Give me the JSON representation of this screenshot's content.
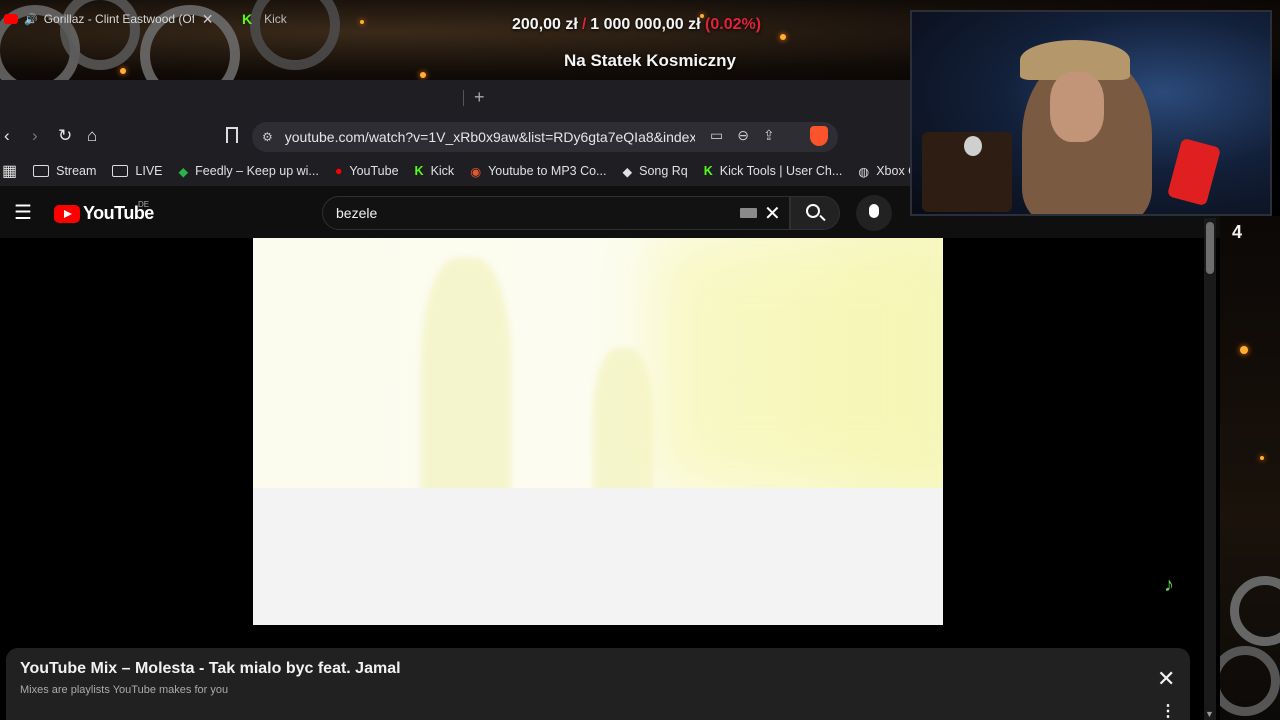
{
  "overlay": {
    "goal_current": "200,00 zł",
    "goal_arrow": "/",
    "goal_target": "1 000 000,00 zł",
    "goal_percent": "(0.02%)",
    "goal_title": "Na Statek Kosmiczny",
    "right_number": "4"
  },
  "browser": {
    "tabs": [
      {
        "label": "Gorillaz - Clint Eastwood (Offi"
      },
      {
        "label": "Kick"
      }
    ],
    "new_tab": "+",
    "url": "youtube.com/watch?v=1V_xRb0x9aw&list=RDy6gta7eQIa8&index...",
    "bookmarks": [
      {
        "label": "Stream"
      },
      {
        "label": "LIVE"
      },
      {
        "label": "Feedly – Keep up wi..."
      },
      {
        "label": "YouTube"
      },
      {
        "label": "Kick"
      },
      {
        "label": "Youtube to MP3 Co..."
      },
      {
        "label": "Song Rq"
      },
      {
        "label": "Kick Tools | User Ch..."
      },
      {
        "label": "Xbox Cl"
      }
    ]
  },
  "youtube": {
    "logo": "YouTube",
    "region": "DE",
    "search_value": "bezele",
    "mix_title": "YouTube Mix – Molesta - Tak mialo byc feat. Jamal",
    "mix_subtitle": "Mixes are playlists YouTube makes for you"
  },
  "colors": {
    "youtube_red": "#ff0000",
    "kick_green": "#53fc18",
    "goal_red": "#e0233a",
    "brave_orange": "#fb542b"
  }
}
